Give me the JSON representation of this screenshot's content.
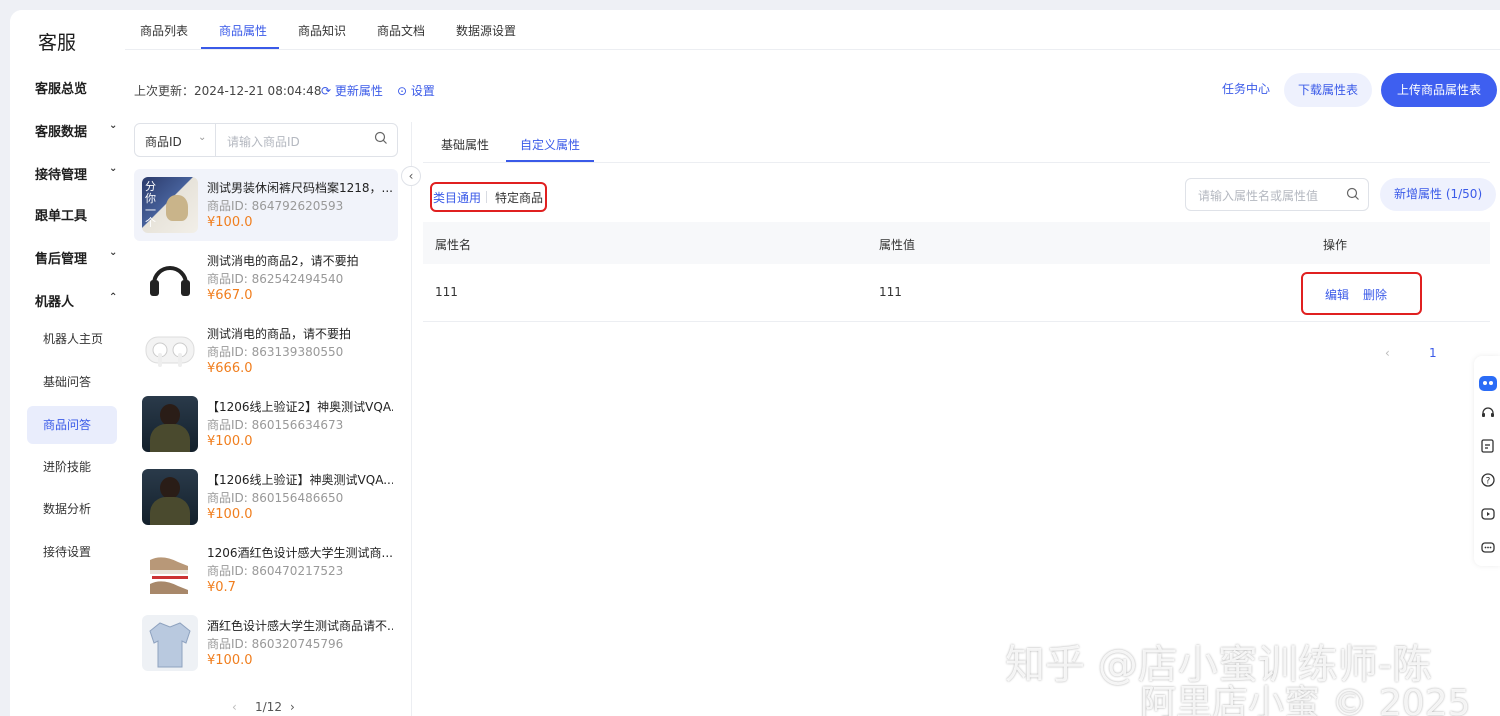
{
  "brand": "客服",
  "nav": {
    "items": [
      {
        "label": "客服总览",
        "chevron": false
      },
      {
        "label": "客服数据",
        "chevron": true,
        "chevron_dir": "down"
      },
      {
        "label": "接待管理",
        "chevron": true,
        "chevron_dir": "down"
      },
      {
        "label": "跟单工具",
        "chevron": false
      },
      {
        "label": "售后管理",
        "chevron": true,
        "chevron_dir": "down"
      },
      {
        "label": "机器人",
        "chevron": true,
        "chevron_dir": "up"
      }
    ],
    "sub_items": [
      "机器人主页",
      "基础问答",
      "商品问答",
      "进阶技能",
      "数据分析",
      "接待设置"
    ],
    "active_sub": "商品问答"
  },
  "top_tabs": [
    "商品列表",
    "商品属性",
    "商品知识",
    "商品文档",
    "数据源设置"
  ],
  "active_top_tab": "商品属性",
  "info": {
    "last_update": "上次更新：2024-12-21 08:04:48",
    "refresh_label": "更新属性",
    "settings_label": "设置"
  },
  "actions": {
    "task_center": "任务中心",
    "download": "下载属性表",
    "upload": "上传商品属性表"
  },
  "product_search": {
    "select_value": "商品ID",
    "placeholder": "请输入商品ID"
  },
  "products": [
    {
      "name": "测试男装休闲裤尺码档案1218，...",
      "id": "商品ID: 864792620593",
      "price": "¥100.0",
      "thumb": "poster"
    },
    {
      "name": "测试消电的商品2，请不要拍",
      "id": "商品ID: 862542494540",
      "price": "¥667.0",
      "thumb": "headphones"
    },
    {
      "name": "测试消电的商品，请不要拍",
      "id": "商品ID: 863139380550",
      "price": "¥666.0",
      "thumb": "earbuds"
    },
    {
      "name": "【1206线上验证2】神奥测试VQA...",
      "id": "商品ID: 860156634673",
      "price": "¥100.0",
      "thumb": "person"
    },
    {
      "name": "【1206线上验证】神奥测试VQA...",
      "id": "商品ID: 860156486650",
      "price": "¥100.0",
      "thumb": "person"
    },
    {
      "name": "1206酒红色设计感大学生测试商...",
      "id": "商品ID: 860470217523",
      "price": "¥0.7",
      "thumb": "shoes"
    },
    {
      "name": "酒红色设计感大学生测试商品请不...",
      "id": "商品ID: 860320745796",
      "price": "¥100.0",
      "thumb": "jacket"
    }
  ],
  "poster_text": "分你一个",
  "product_pager": "1/12",
  "sub_tabs": [
    "基础属性",
    "自定义属性"
  ],
  "active_sub_tab": "自定义属性",
  "segment": {
    "a": "类目通用",
    "b": "特定商品"
  },
  "attr_search_placeholder": "请输入属性名或属性值",
  "add_attr_label": "新增属性 (1/50)",
  "table": {
    "headers": [
      "属性名",
      "属性值",
      "操作"
    ],
    "rows": [
      {
        "name": "111",
        "value": "111",
        "edit": "编辑",
        "delete": "删除"
      }
    ]
  },
  "pagination": {
    "current": "1"
  },
  "watermark": [
    "知乎 @店小蜜训练师-陈",
    "阿里店小蜜 © 2025"
  ],
  "colors": {
    "accent": "#3a5ae8",
    "price": "#f07e1e",
    "highlight": "#e02020"
  }
}
